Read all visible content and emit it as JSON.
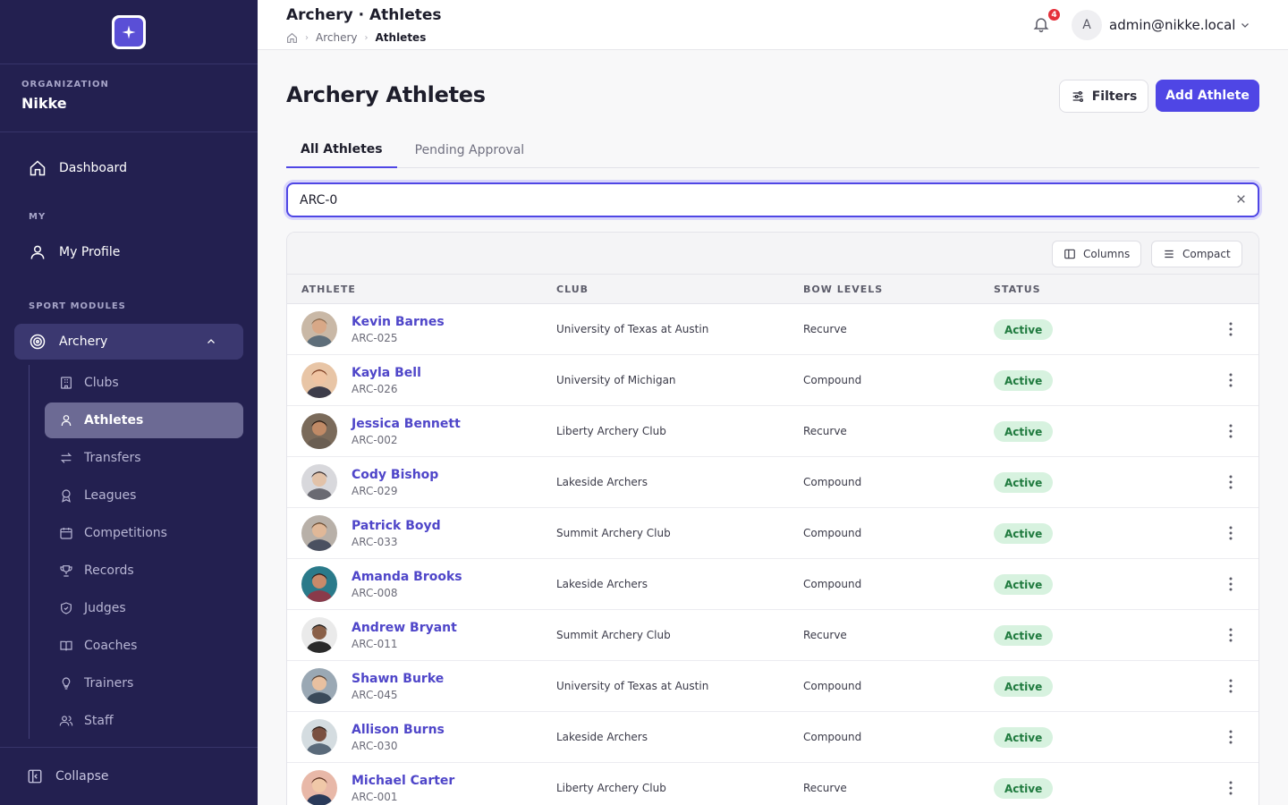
{
  "sidebar": {
    "org_label": "ORGANIZATION",
    "org_name": "Nikke",
    "dashboard": "Dashboard",
    "my_section": "MY",
    "my_profile": "My Profile",
    "sport_section": "SPORT MODULES",
    "archery": "Archery",
    "sub_items": [
      {
        "label": "Clubs",
        "icon": "building-icon"
      },
      {
        "label": "Athletes",
        "icon": "user-icon"
      },
      {
        "label": "Transfers",
        "icon": "transfer-icon"
      },
      {
        "label": "Leagues",
        "icon": "award-icon"
      },
      {
        "label": "Competitions",
        "icon": "calendar-icon"
      },
      {
        "label": "Records",
        "icon": "trophy-icon"
      },
      {
        "label": "Judges",
        "icon": "shield-icon"
      },
      {
        "label": "Coaches",
        "icon": "book-icon"
      },
      {
        "label": "Trainers",
        "icon": "bulb-icon"
      },
      {
        "label": "Staff",
        "icon": "users-icon"
      }
    ],
    "collapse": "Collapse"
  },
  "header": {
    "title": "Archery · Athletes",
    "breadcrumb": [
      "Archery",
      "Athletes"
    ],
    "notifications": "4",
    "avatar_initial": "A",
    "user": "admin@nikke.local"
  },
  "main": {
    "page_title": "Archery Athletes",
    "filters": "Filters",
    "add": "Add Athlete",
    "tabs": [
      "All Athletes",
      "Pending Approval"
    ],
    "search_value": "ARC-0",
    "columns_btn": "Columns",
    "compact_btn": "Compact",
    "headers": [
      "ATHLETE",
      "CLUB",
      "BOW LEVELS",
      "STATUS"
    ],
    "rows": [
      {
        "name": "Kevin Barnes",
        "code": "ARC-025",
        "club": "University of Texas at Austin",
        "bow": "Recurve",
        "status": "Active"
      },
      {
        "name": "Kayla Bell",
        "code": "ARC-026",
        "club": "University of Michigan",
        "bow": "Compound",
        "status": "Active"
      },
      {
        "name": "Jessica Bennett",
        "code": "ARC-002",
        "club": "Liberty Archery Club",
        "bow": "Recurve",
        "status": "Active"
      },
      {
        "name": "Cody Bishop",
        "code": "ARC-029",
        "club": "Lakeside Archers",
        "bow": "Compound",
        "status": "Active"
      },
      {
        "name": "Patrick Boyd",
        "code": "ARC-033",
        "club": "Summit Archery Club",
        "bow": "Compound",
        "status": "Active"
      },
      {
        "name": "Amanda Brooks",
        "code": "ARC-008",
        "club": "Lakeside Archers",
        "bow": "Compound",
        "status": "Active"
      },
      {
        "name": "Andrew Bryant",
        "code": "ARC-011",
        "club": "Summit Archery Club",
        "bow": "Recurve",
        "status": "Active"
      },
      {
        "name": "Shawn Burke",
        "code": "ARC-045",
        "club": "University of Texas at Austin",
        "bow": "Compound",
        "status": "Active"
      },
      {
        "name": "Allison Burns",
        "code": "ARC-030",
        "club": "Lakeside Archers",
        "bow": "Compound",
        "status": "Active"
      },
      {
        "name": "Michael Carter",
        "code": "ARC-001",
        "club": "Liberty Archery Club",
        "bow": "Recurve",
        "status": "Active"
      }
    ]
  },
  "colors": {
    "sidebar_bg": "#232050",
    "accent": "#4f46e5",
    "active_badge_bg": "#d7f2df",
    "active_badge_text": "#1f7a3e",
    "notification": "#e5303a"
  }
}
